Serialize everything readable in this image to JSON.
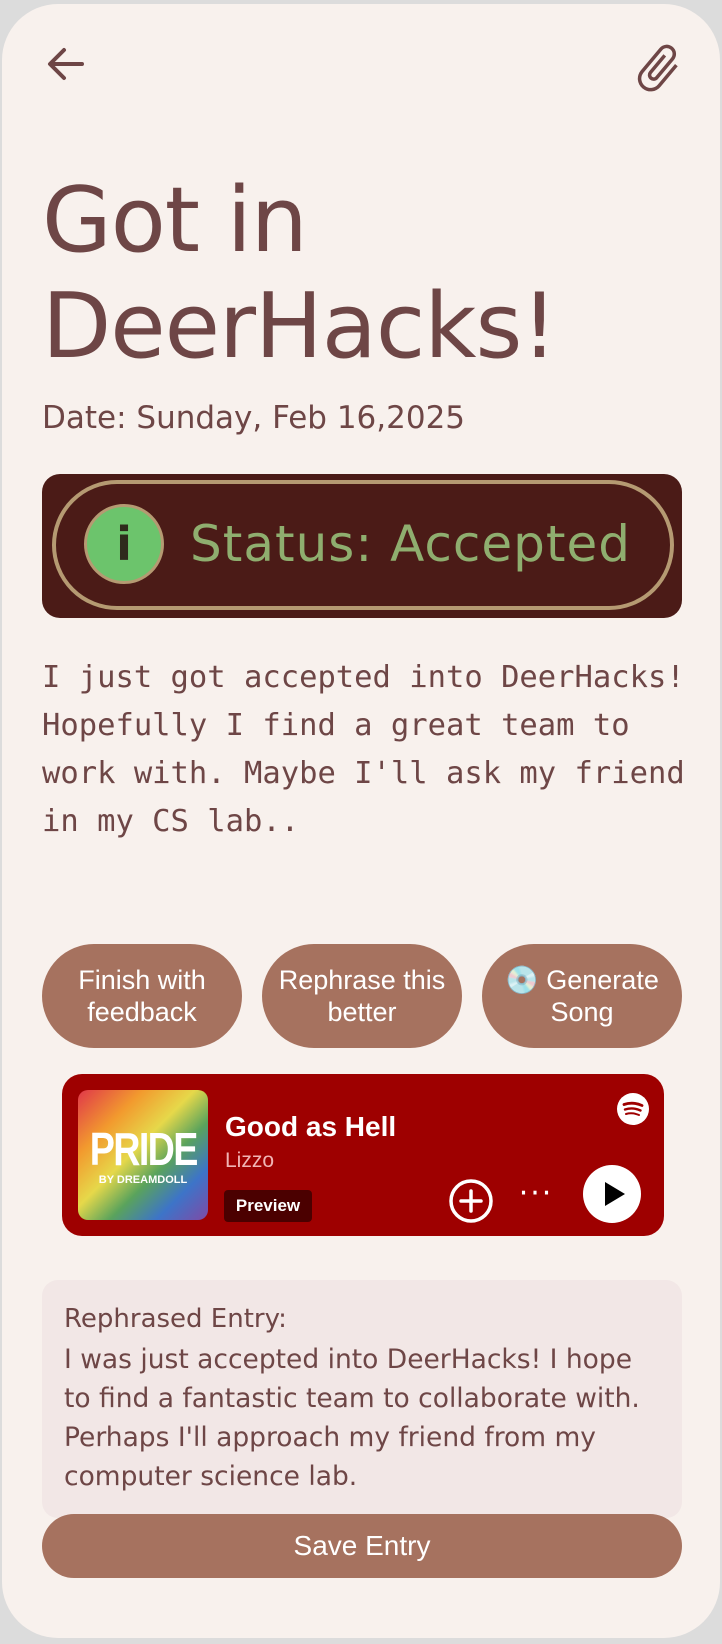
{
  "header": {
    "back_icon": "arrow-left-icon",
    "attach_icon": "paperclip-icon"
  },
  "entry": {
    "title": "Got in DeerHacks!",
    "date": "Date: Sunday, Feb 16,2025",
    "status_text": "Status: Accepted",
    "status_icon": "info-icon",
    "status_icon_glyph": "i",
    "body": "I just got accepted into DeerHacks! Hopefully I find a great team to work with. Maybe I'll ask my friend in my CS lab.."
  },
  "actions": {
    "finish_label": "Finish with feedback",
    "rephrase_label": "Rephrase this better",
    "generate_label": "💿 Generate Song"
  },
  "song": {
    "title": "Good as Hell",
    "artist": "Lizzo",
    "badge": "Preview",
    "album_title": "PRIDE",
    "album_subtitle": "BY DREAMDOLL",
    "more_glyph": "···",
    "brand_icon": "spotify-icon",
    "add_icon": "plus-circle-icon",
    "more_icon": "more-dots-icon",
    "play_icon": "play-icon",
    "brand_color": "#9e0000"
  },
  "rephrased": {
    "heading": "Rephrased Entry:",
    "text": "I was just accepted into DeerHacks! I hope to find a fantastic team to collaborate with. Perhaps I'll approach my friend from my computer science lab."
  },
  "footer": {
    "save_label": "Save Entry"
  },
  "colors": {
    "background": "#f8f1ed",
    "text": "#6e4646",
    "button": "#a6725f"
  }
}
